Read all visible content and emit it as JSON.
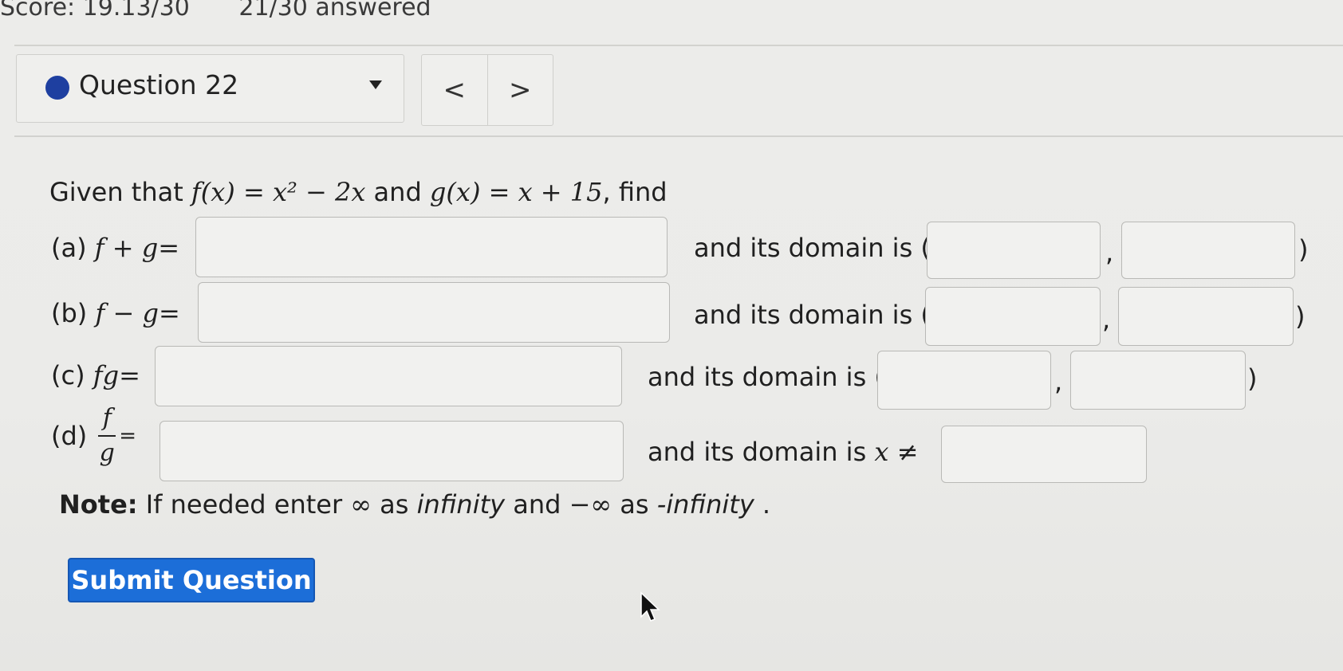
{
  "header": {
    "score": "Score: 19.13/30",
    "answered": "21/30 answered"
  },
  "question_selector": {
    "label": "Question 22",
    "prev_icon": "<",
    "next_icon": ">"
  },
  "prompt": {
    "given": "Given that",
    "f_def": "f(x) = x² − 2x",
    "and": "and",
    "g_def": "g(x) = x + 15",
    "find": ", find"
  },
  "parts": {
    "a": {
      "label": "(a)",
      "expr": "f + g=",
      "domain_text": "and its domain is (",
      "comma": ",",
      "close": ")"
    },
    "b": {
      "label": "(b)",
      "expr": "f − g=",
      "domain_text": "and its domain is (",
      "comma": ",",
      "close": ")"
    },
    "c": {
      "label": "(c)",
      "expr": "fg=",
      "domain_text": "and its domain is (",
      "comma": ",",
      "close": ")"
    },
    "d": {
      "label": "(d)",
      "num": "f",
      "den": "g",
      "eq": "=",
      "domain_text": "and its domain is",
      "neq": "x ≠"
    }
  },
  "note": {
    "bold": "Note:",
    "t1": " If needed enter ",
    "inf": "∞",
    "t2": " as ",
    "infinity": "infinity",
    "t3": " and ",
    "neginf": "−∞",
    "t4": " as ",
    "neginfinity": "-infinity",
    "t5": " ."
  },
  "submit": {
    "label": "Submit Question"
  },
  "colors": {
    "accent": "#1c6ed8",
    "indicator": "#1e3fa0"
  }
}
